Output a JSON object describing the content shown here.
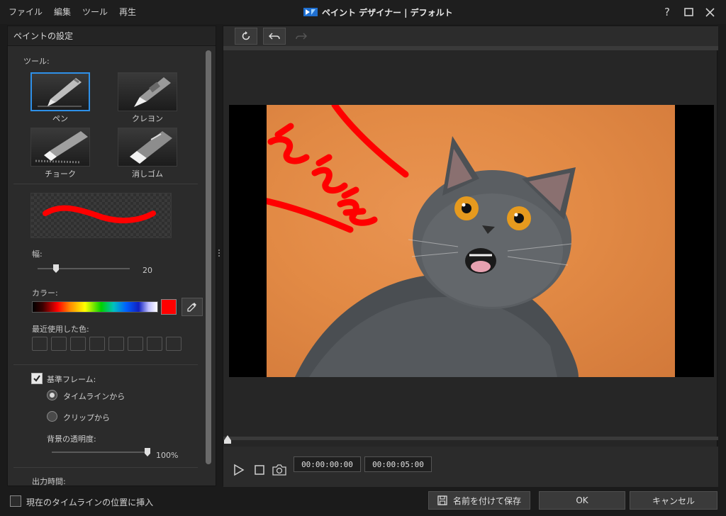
{
  "menu": [
    "ファイル",
    "編集",
    "ツール",
    "再生"
  ],
  "window": {
    "title": "ペイント デザイナー  |  デフォルト",
    "help": "?"
  },
  "panel": {
    "title": "ペイントの設定",
    "tools_label": "ツール:",
    "tools": [
      {
        "name": "ペン",
        "selected": true
      },
      {
        "name": "クレヨン",
        "selected": false
      },
      {
        "name": "チョーク",
        "selected": false
      },
      {
        "name": "消しゴム",
        "selected": false
      }
    ],
    "width_label": "幅:",
    "width_value": "20",
    "width_level": 0.2,
    "color_label": "カラー:",
    "current_color": "#ff0000",
    "recent_label": "最近使用した色:",
    "recent_count": 8,
    "ref_frame_label": "基準フレーム:",
    "ref_frame_checked": true,
    "radio_timeline": "タイムラインから",
    "radio_clip": "クリップから",
    "bg_opacity_label": "背景の透明度:",
    "bg_opacity_value": "100%",
    "bg_opacity_level": 1.0,
    "output_time_label": "出力時間:"
  },
  "player": {
    "time_start": "00:00:00:00",
    "time_end": "00:00:05:00",
    "timeline_position": 0
  },
  "bottom": {
    "insert_label": "現在のタイムラインの位置に挿入",
    "save_as_label": "名前を付けて保存",
    "ok_label": "OK",
    "cancel_label": "キャンセル"
  },
  "colors": {
    "accent": "#2e90e8",
    "paint": "#ff0000",
    "background": "#e28a45"
  }
}
